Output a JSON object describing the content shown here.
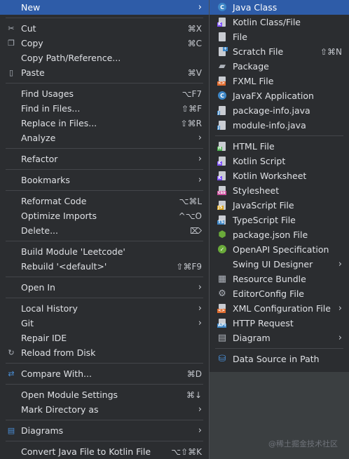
{
  "main_menu": {
    "new": {
      "label": "New"
    },
    "cut": {
      "label": "Cut",
      "shortcut": "⌘X"
    },
    "copy": {
      "label": "Copy",
      "shortcut": "⌘C"
    },
    "copy_path": {
      "label": "Copy Path/Reference..."
    },
    "paste": {
      "label": "Paste",
      "shortcut": "⌘V"
    },
    "find_usages": {
      "label": "Find Usages",
      "shortcut": "⌥F7"
    },
    "find_in_files": {
      "label": "Find in Files...",
      "shortcut": "⇧⌘F"
    },
    "replace_in_files": {
      "label": "Replace in Files...",
      "shortcut": "⇧⌘R"
    },
    "analyze": {
      "label": "Analyze"
    },
    "refactor": {
      "label": "Refactor"
    },
    "bookmarks": {
      "label": "Bookmarks"
    },
    "reformat_code": {
      "label": "Reformat Code",
      "shortcut": "⌥⌘L"
    },
    "optimize_imports": {
      "label": "Optimize Imports",
      "shortcut": "^⌥O"
    },
    "delete": {
      "label": "Delete...",
      "shortcut": "⌦"
    },
    "build_module": {
      "label": "Build Module 'Leetcode'"
    },
    "rebuild": {
      "label": "Rebuild '<default>'",
      "shortcut": "⇧⌘F9"
    },
    "open_in": {
      "label": "Open In"
    },
    "local_history": {
      "label": "Local History"
    },
    "git": {
      "label": "Git"
    },
    "repair_ide": {
      "label": "Repair IDE"
    },
    "reload_from_disk": {
      "label": "Reload from Disk"
    },
    "compare_with": {
      "label": "Compare With...",
      "shortcut": "⌘D"
    },
    "open_module_settings": {
      "label": "Open Module Settings",
      "shortcut": "⌘↓"
    },
    "mark_directory_as": {
      "label": "Mark Directory as"
    },
    "diagrams": {
      "label": "Diagrams"
    },
    "convert_java": {
      "label": "Convert Java File to Kotlin File",
      "shortcut": "⌥⇧⌘K"
    }
  },
  "sub_menu": {
    "java_class": {
      "label": "Java Class"
    },
    "kotlin_class_file": {
      "label": "Kotlin Class/File"
    },
    "file": {
      "label": "File"
    },
    "scratch_file": {
      "label": "Scratch File",
      "shortcut": "⇧⌘N"
    },
    "package": {
      "label": "Package"
    },
    "fxml_file": {
      "label": "FXML File"
    },
    "javafx_application": {
      "label": "JavaFX Application"
    },
    "package_info": {
      "label": "package-info.java"
    },
    "module_info": {
      "label": "module-info.java"
    },
    "html_file": {
      "label": "HTML File"
    },
    "kotlin_script": {
      "label": "Kotlin Script"
    },
    "kotlin_worksheet": {
      "label": "Kotlin Worksheet"
    },
    "stylesheet": {
      "label": "Stylesheet"
    },
    "javascript_file": {
      "label": "JavaScript File"
    },
    "typescript_file": {
      "label": "TypeScript File"
    },
    "package_json": {
      "label": "package.json File"
    },
    "openapi_spec": {
      "label": "OpenAPI Specification"
    },
    "swing_ui_designer": {
      "label": "Swing UI Designer"
    },
    "resource_bundle": {
      "label": "Resource Bundle"
    },
    "editorconfig_file": {
      "label": "EditorConfig File"
    },
    "xml_configuration_file": {
      "label": "XML Configuration File"
    },
    "http_request": {
      "label": "HTTP Request"
    },
    "diagram": {
      "label": "Diagram"
    },
    "data_source_in_path": {
      "label": "Data Source in Path"
    }
  },
  "watermark": {
    "text": "@稀土掘金技术社区"
  },
  "colors": {
    "menu_bg": "#2b2d30",
    "selected_bg": "#2e5ca8",
    "separator": "#43454a",
    "text": "#dfe1e5"
  }
}
